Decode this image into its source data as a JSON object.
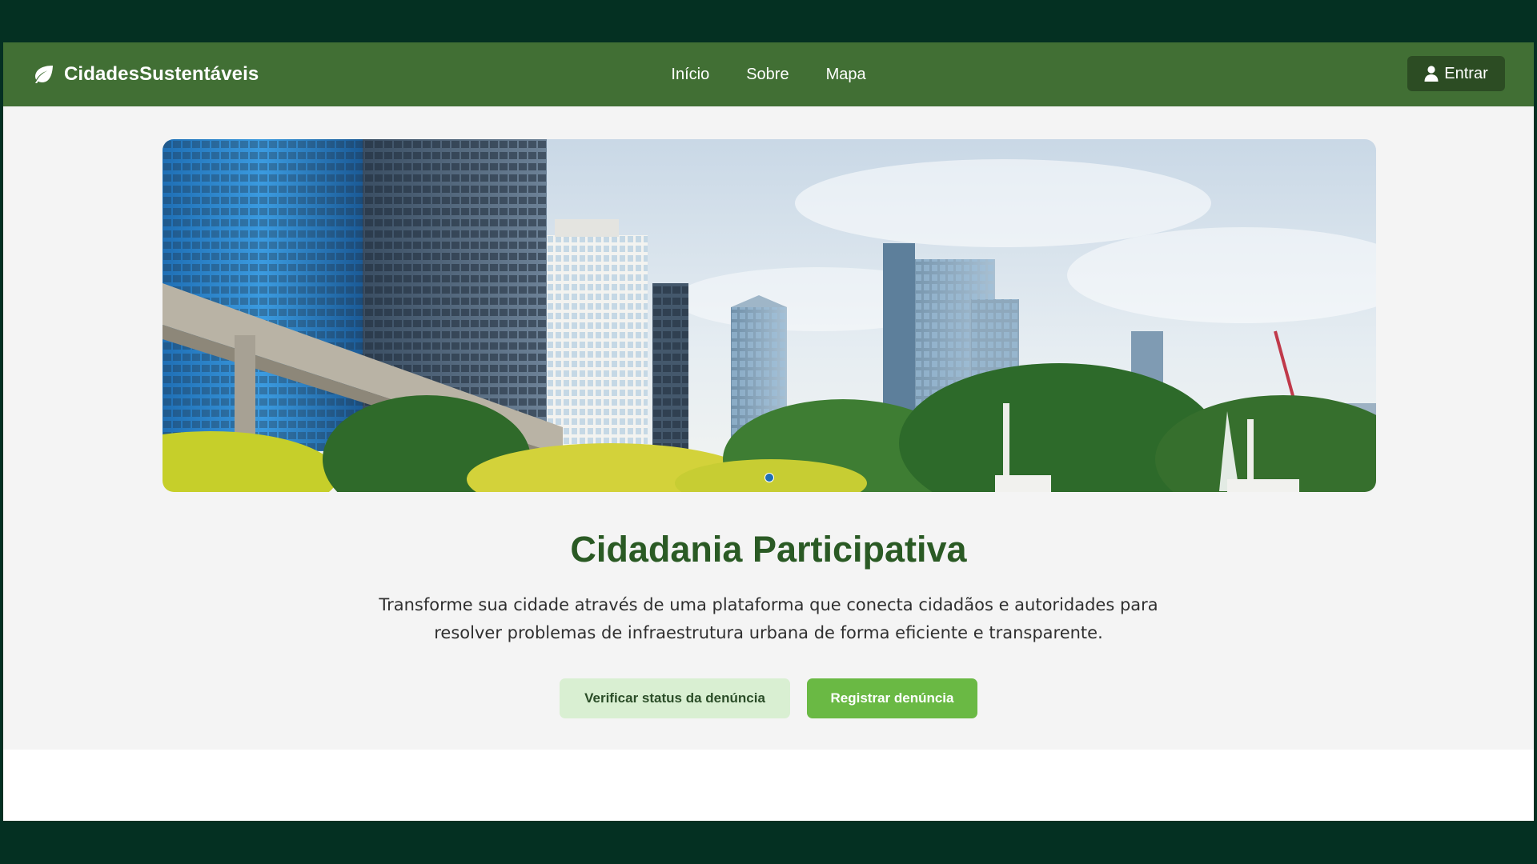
{
  "navbar": {
    "brand": "CidadesSustentáveis",
    "brand_icon": "leaf-icon",
    "links": [
      "Início",
      "Sobre",
      "Mapa"
    ],
    "login_label": "Entrar",
    "login_icon": "user-icon"
  },
  "hero": {
    "banner_image": "city-skyline-with-park-image",
    "carousel_slides": 1,
    "title": "Cidadania Participativa",
    "description": "Transforme sua cidade através de uma plataforma que conecta cidadãos e autoridades para resolver problemas de infraestrutura urbana de forma eficiente e transparente.",
    "secondary_button": "Verificar status da denúncia",
    "primary_button": "Registrar denúncia"
  },
  "colors": {
    "page_background": "#043022",
    "navbar": "#416f34",
    "login_button": "#2c4c23",
    "hero_background": "#f4f4f4",
    "title": "#2a5a24",
    "secondary_button": "#d9efd2",
    "primary_button": "#6ab944",
    "carousel_dot": "#1e6fb6"
  }
}
